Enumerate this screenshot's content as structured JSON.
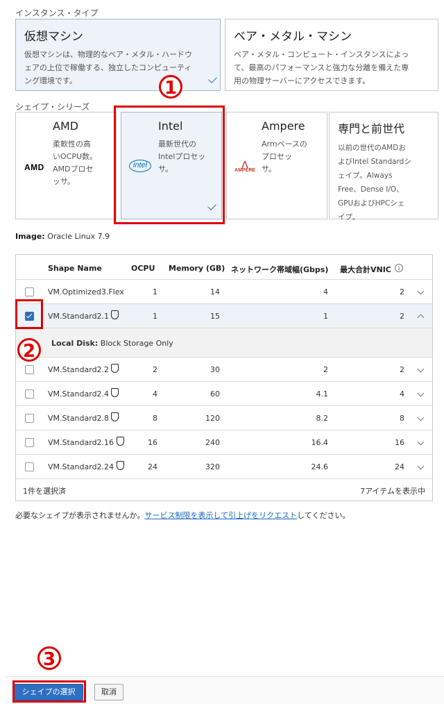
{
  "instance_type": {
    "label": "インスタンス・タイプ",
    "cards": [
      {
        "title": "仮想マシン",
        "desc": [
          "仮想マシンは、物理的なベア・メタル・ハードウ",
          "ェアの上位で稼働する、独立したコンピューティ",
          "ング環境です。"
        ],
        "selected": true
      },
      {
        "title": "ベア・メタル・マシン",
        "desc": [
          "ベア・メタル・コンピュート・インスタンスによっ",
          "て、最高のパフォーマンスと強力な分離を備えた専",
          "用の物理サーバーにアクセスできます。"
        ],
        "selected": false
      }
    ]
  },
  "shape_series": {
    "label": "シェイプ・シリーズ",
    "cards": [
      {
        "title": "AMD",
        "desc": [
          "柔軟性の高",
          "いOCPU数。",
          "AMDプロセ",
          "ッサ。"
        ],
        "logo": "AMD",
        "selected": false
      },
      {
        "title": "Intel",
        "desc": [
          "最新世代の",
          "Intelプロセッ",
          "サ。"
        ],
        "logo": "intel",
        "selected": true
      },
      {
        "title": "Ampere",
        "desc": [
          "Armベースの",
          "プロセッ",
          "サ。"
        ],
        "logo": "AMPERE",
        "selected": false
      },
      {
        "title": "専門と前世代",
        "desc": [
          "以前の世代のAMDお",
          "よびIntel Standardシ",
          "ェイプ。Always",
          "Free、Dense I/O、",
          "GPUおよびHPCシェ",
          "イプ。"
        ],
        "selected": false
      }
    ]
  },
  "image": {
    "label": "Image:",
    "value": "Oracle Linux 7.9"
  },
  "table": {
    "headers": [
      "Shape Name",
      "OCPU",
      "Memory (GB)",
      "ネットワーク帯域幅(Gbps)",
      "最大合計VNIC"
    ],
    "rows": [
      {
        "name": "VM.Optimized3.Flex",
        "ocpu": "1",
        "mem": "14",
        "net": "4",
        "vnic": "2",
        "checked": false,
        "shield": false
      },
      {
        "name": "VM.Standard2.1",
        "ocpu": "1",
        "mem": "15",
        "net": "1",
        "vnic": "2",
        "checked": true,
        "shield": true
      },
      {
        "name": "VM.Standard2.2",
        "ocpu": "2",
        "mem": "30",
        "net": "2",
        "vnic": "2",
        "checked": false,
        "shield": true
      },
      {
        "name": "VM.Standard2.4",
        "ocpu": "4",
        "mem": "60",
        "net": "4.1",
        "vnic": "4",
        "checked": false,
        "shield": true
      },
      {
        "name": "VM.Standard2.8",
        "ocpu": "8",
        "mem": "120",
        "net": "8.2",
        "vnic": "8",
        "checked": false,
        "shield": true
      },
      {
        "name": "VM.Standard2.16",
        "ocpu": "16",
        "mem": "240",
        "net": "16.4",
        "vnic": "16",
        "checked": false,
        "shield": true
      },
      {
        "name": "VM.Standard2.24",
        "ocpu": "24",
        "mem": "320",
        "net": "24.6",
        "vnic": "24",
        "checked": false,
        "shield": true
      }
    ],
    "detail": {
      "label": "Local Disk:",
      "value": "Block Storage Only"
    },
    "footer_left": "1件を選択済",
    "footer_right": "7アイテムを表示中"
  },
  "note": {
    "prefix": "必要なシェイプが表示されませんか。",
    "link": "サービス制限を表示して引上げをリクエスト",
    "suffix": "してください。"
  },
  "buttons": {
    "select": "シェイプの選択",
    "cancel": "取消"
  },
  "annotations": {
    "one": "1",
    "two": "2",
    "three": "3"
  },
  "colors": {
    "accent": "#2d6fc1",
    "annotation": "#e00000",
    "selected_bg": "#eef3f9"
  }
}
